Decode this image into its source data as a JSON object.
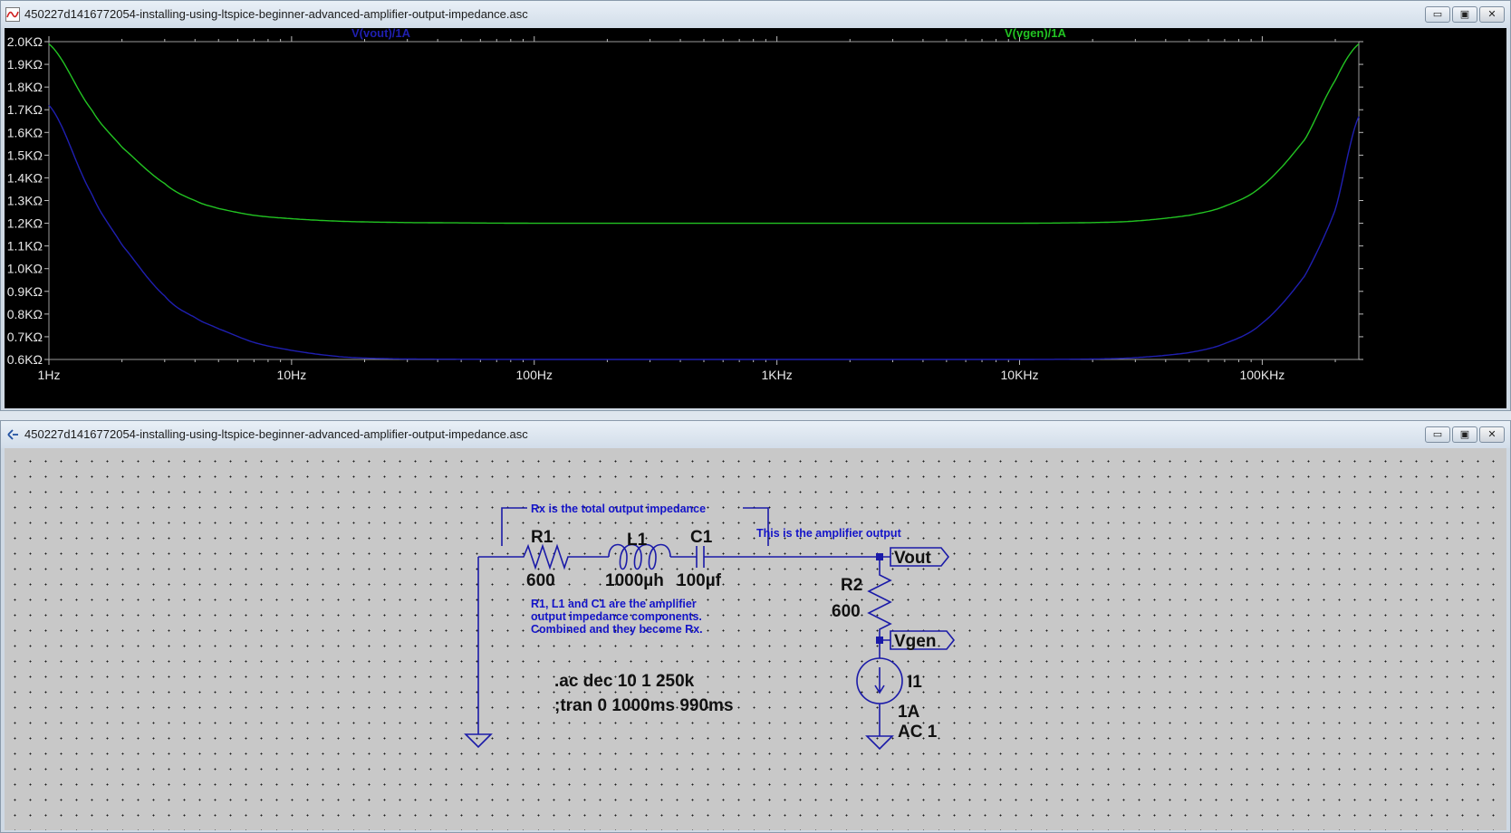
{
  "plot_window": {
    "title": "450227d1416772054-installing-using-ltspice-beginner-advanced-amplifier-output-impedance.asc",
    "controls": [
      "▭",
      "▣",
      "✕"
    ]
  },
  "schematic_window": {
    "title": "450227d1416772054-installing-using-ltspice-beginner-advanced-amplifier-output-impedance.asc",
    "controls": [
      "▭",
      "▣",
      "✕"
    ]
  },
  "chart_data": {
    "type": "line",
    "x_scale": "log",
    "xlim": [
      1,
      250000
    ],
    "ylim": [
      600,
      2000
    ],
    "x_ticks": [
      {
        "value": 1,
        "label": "1Hz"
      },
      {
        "value": 10,
        "label": "10Hz"
      },
      {
        "value": 100,
        "label": "100Hz"
      },
      {
        "value": 1000,
        "label": "1KHz"
      },
      {
        "value": 10000,
        "label": "10KHz"
      },
      {
        "value": 100000,
        "label": "100KHz"
      }
    ],
    "y_ticks": [
      {
        "value": 2000,
        "label": "2.0KΩ"
      },
      {
        "value": 1900,
        "label": "1.9KΩ"
      },
      {
        "value": 1800,
        "label": "1.8KΩ"
      },
      {
        "value": 1700,
        "label": "1.7KΩ"
      },
      {
        "value": 1600,
        "label": "1.6KΩ"
      },
      {
        "value": 1500,
        "label": "1.5KΩ"
      },
      {
        "value": 1400,
        "label": "1.4KΩ"
      },
      {
        "value": 1300,
        "label": "1.3KΩ"
      },
      {
        "value": 1200,
        "label": "1.2KΩ"
      },
      {
        "value": 1100,
        "label": "1.1KΩ"
      },
      {
        "value": 1000,
        "label": "1.0KΩ"
      },
      {
        "value": 900,
        "label": "0.9KΩ"
      },
      {
        "value": 800,
        "label": "0.8KΩ"
      },
      {
        "value": 700,
        "label": "0.7KΩ"
      },
      {
        "value": 600,
        "label": "0.6KΩ"
      }
    ],
    "grid": false,
    "series": [
      {
        "name": "V(vout)/1A",
        "color": "#1f1fb0",
        "x": [
          1,
          1.5,
          2,
          3,
          4,
          5,
          7,
          10,
          15,
          20,
          30,
          100,
          1000,
          10000,
          20000,
          30000,
          50000,
          70000,
          100000,
          150000,
          200000,
          250000
        ],
        "y": [
          1720,
          1330,
          1105,
          880,
          785,
          735,
          675,
          640,
          615,
          606,
          602,
          600,
          600,
          600,
          602,
          608,
          630,
          670,
          760,
          970,
          1260,
          1670
        ]
      },
      {
        "name": "V(vgen)/1A",
        "color": "#22c322",
        "x": [
          1,
          1.5,
          2,
          3,
          4,
          5,
          7,
          10,
          15,
          20,
          30,
          100,
          1000,
          10000,
          20000,
          30000,
          50000,
          70000,
          100000,
          150000,
          200000,
          250000
        ],
        "y": [
          1990,
          1700,
          1535,
          1375,
          1300,
          1265,
          1235,
          1220,
          1210,
          1206,
          1203,
          1200,
          1200,
          1200,
          1203,
          1210,
          1235,
          1275,
          1365,
          1570,
          1830,
          1990
        ]
      }
    ]
  },
  "schematic": {
    "components": {
      "r1": {
        "name": "R1",
        "value": "600"
      },
      "l1": {
        "name": "L1",
        "value": "1000µh"
      },
      "c1": {
        "name": "C1",
        "value": "100µf"
      },
      "r2": {
        "name": "R2",
        "value": "600"
      },
      "i1": {
        "name": "I1",
        "value": "1A",
        "value2": "AC 1"
      }
    },
    "nets": {
      "vout": "Vout",
      "vgen": "Vgen"
    },
    "comments": {
      "rx_total": "Rx is the total output impedance",
      "amp_output": "This is the amplifier output",
      "desc_line1": "R1, L1 and C1 are the amplifier",
      "desc_line2": "output impedance components.",
      "desc_line3": "Combined and they become Rx."
    },
    "directives": {
      "ac": ".ac dec 10 1 250k",
      "tran": ";tran 0 1000ms 990ms"
    },
    "colors": {
      "wire": "#1a1aa8",
      "comment": "#1414c8",
      "background": "#c8c8c8"
    }
  }
}
